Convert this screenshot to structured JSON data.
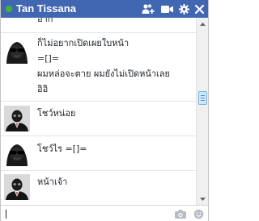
{
  "window": {
    "title": "Tan Tissana",
    "status": "online",
    "status_color": "#42b72a",
    "header_color": "#4267b2",
    "actions": [
      {
        "name": "add-friend-icon"
      },
      {
        "name": "video-call-icon"
      },
      {
        "name": "settings-gear-icon"
      },
      {
        "name": "close-icon"
      }
    ]
  },
  "messages": [
    {
      "lines": [
        "อาก"
      ],
      "avatar": "none"
    },
    {
      "lines": [
        "ก็ไม่อยากเปิดเผยใบหน้า",
        "=[]=",
        "ผมหล่อจะตาย ผมยังไม่เปิดหน้าเลย",
        "อิอิ"
      ],
      "avatar": "hooded-figure-sunglasses"
    },
    {
      "lines": [
        "โชว์หน่อย"
      ],
      "avatar": "man-in-suit"
    },
    {
      "lines": [
        "โชว์ไร =[]="
      ],
      "avatar": "hooded-figure-sunglasses"
    },
    {
      "lines": [
        "หน้าเจ้า"
      ],
      "avatar": "man-in-suit"
    }
  ],
  "composer": {
    "value": "",
    "icons": [
      {
        "name": "camera-icon"
      },
      {
        "name": "emoji-icon"
      }
    ]
  }
}
